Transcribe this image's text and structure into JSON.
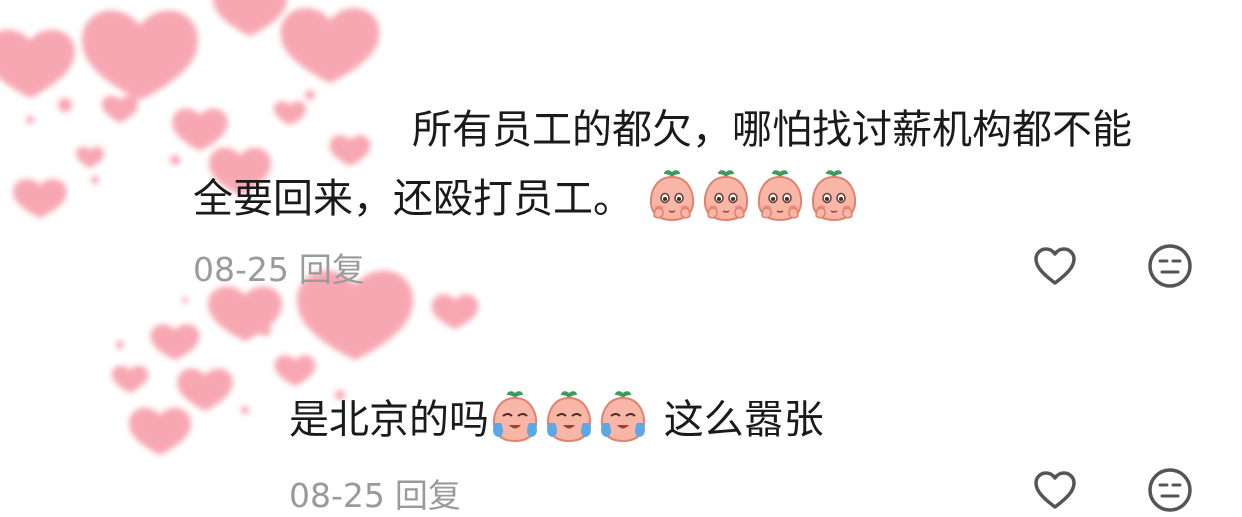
{
  "comments": [
    {
      "line1": "所有员工的都欠，哪怕找讨薪机构都不能",
      "line2": "全要回来，还殴打员工。",
      "emoji_icons": [
        "peach-face-hands-icon",
        "peach-face-hands-icon",
        "peach-face-hands-icon",
        "peach-face-hands-icon"
      ],
      "date": "08-25",
      "reply_label": "回复",
      "like_icon": "heart-outline-icon",
      "dislike_icon": "meh-face-icon"
    },
    {
      "text_before": "是北京的吗",
      "text_after": " 这么嚣张",
      "emoji_icons": [
        "peach-face-crying-icon",
        "peach-face-crying-icon",
        "peach-face-crying-icon"
      ],
      "date": "08-25",
      "reply_label": "回复",
      "like_icon": "heart-outline-icon",
      "dislike_icon": "meh-face-icon"
    }
  ],
  "colors": {
    "text": "#1a1a1a",
    "meta": "#9a9a9a",
    "icon": "#555555",
    "heart_decor": "#f58a98",
    "peach": "#f7b6a6",
    "leaf": "#3e9b5e"
  }
}
